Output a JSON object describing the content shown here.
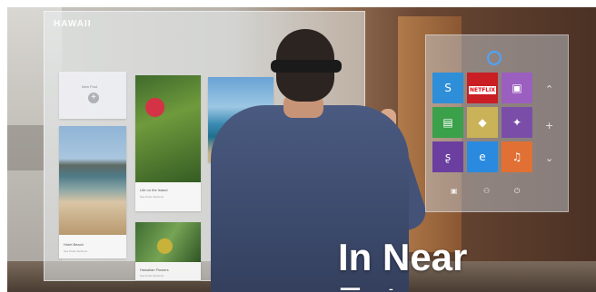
{
  "window": {
    "title": "HAWAII"
  },
  "cards": {
    "new_post": "New Post",
    "beach": {
      "title": "Hotel Beach",
      "meta": "See Posts Sections"
    },
    "flowers": {
      "title": "Life on the Island",
      "meta": "See Posts Sections"
    },
    "tropical": {
      "title": "Hawaiian Flowers",
      "meta": "See Posts Sections"
    }
  },
  "start_menu": {
    "tiles": [
      {
        "name": "skype-tile",
        "icon": "skype-icon",
        "glyph": "S",
        "color": "#2e8fd8"
      },
      {
        "name": "netflix-tile",
        "icon": "netflix-logo",
        "label": "NETFLIX",
        "color": "#c91e24"
      },
      {
        "name": "purple-app-tile",
        "icon": "app-icon",
        "glyph": "▣",
        "color": "#9b5fc0"
      },
      {
        "name": "store-tile",
        "icon": "store-icon",
        "glyph": "▤",
        "color": "#3aa04a"
      },
      {
        "name": "game-tile",
        "icon": "game-icon",
        "glyph": "◆",
        "color": "#c9b258"
      },
      {
        "name": "compass-tile",
        "icon": "compass-icon",
        "glyph": "✦",
        "color": "#7a4ea8"
      },
      {
        "name": "shazam-tile",
        "icon": "shazam-icon",
        "glyph": "ʂ",
        "color": "#6b3fa0"
      },
      {
        "name": "edge-tile",
        "icon": "edge-icon",
        "glyph": "e",
        "color": "#2a8ae0"
      },
      {
        "name": "music-tile",
        "icon": "headphones-icon",
        "glyph": "♫",
        "color": "#e07034"
      }
    ],
    "side_icons": [
      "chevron-up-icon",
      "plus-icon",
      "chevron-down-icon"
    ],
    "bottom_icons": [
      "photo-icon",
      "people-icon",
      "power-icon"
    ]
  },
  "overlay": {
    "line1": "In Near",
    "line2": "Fut"
  }
}
